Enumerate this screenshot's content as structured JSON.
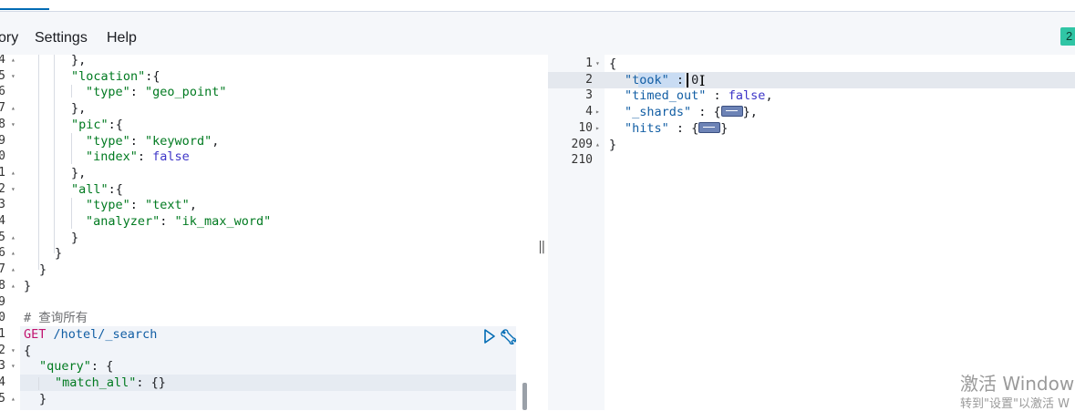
{
  "menu": {
    "history": "ory",
    "settings": "Settings",
    "help": "Help"
  },
  "status_badge": "2",
  "request_editor": {
    "lines": [
      {
        "num": "4",
        "fold": "▴",
        "code": [
          [
            "p",
            "},"
          ]
        ]
      },
      {
        "num": "5",
        "fold": "▾",
        "code": [
          [
            "s",
            "\"location\""
          ],
          [
            "p",
            ":{"
          ]
        ]
      },
      {
        "num": "6",
        "fold": "",
        "code": [
          [
            "s",
            "\"type\""
          ],
          [
            "p",
            ": "
          ],
          [
            "s",
            "\"geo_point\""
          ]
        ]
      },
      {
        "num": "7",
        "fold": "▴",
        "code": [
          [
            "p",
            "},"
          ]
        ]
      },
      {
        "num": "8",
        "fold": "▾",
        "code": [
          [
            "s",
            "\"pic\""
          ],
          [
            "p",
            ":{"
          ]
        ]
      },
      {
        "num": "9",
        "fold": "",
        "code": [
          [
            "s",
            "\"type\""
          ],
          [
            "p",
            ": "
          ],
          [
            "s",
            "\"keyword\""
          ],
          [
            "p",
            ","
          ]
        ]
      },
      {
        "num": "0",
        "fold": "",
        "code": [
          [
            "s",
            "\"index\""
          ],
          [
            "p",
            ": "
          ],
          [
            "b",
            "false"
          ]
        ]
      },
      {
        "num": "1",
        "fold": "▴",
        "code": [
          [
            "p",
            "},"
          ]
        ]
      },
      {
        "num": "2",
        "fold": "▾",
        "code": [
          [
            "s",
            "\"all\""
          ],
          [
            "p",
            ":{"
          ]
        ]
      },
      {
        "num": "3",
        "fold": "",
        "code": [
          [
            "s",
            "\"type\""
          ],
          [
            "p",
            ": "
          ],
          [
            "s",
            "\"text\""
          ],
          [
            "p",
            ","
          ]
        ]
      },
      {
        "num": "4",
        "fold": "",
        "code": [
          [
            "s",
            "\"analyzer\""
          ],
          [
            "p",
            ": "
          ],
          [
            "s",
            "\"ik_max_word\""
          ]
        ]
      },
      {
        "num": "5",
        "fold": "▴",
        "code": [
          [
            "p",
            "}"
          ]
        ]
      },
      {
        "num": "6",
        "fold": "▴",
        "code": [
          [
            "p",
            "}"
          ]
        ]
      },
      {
        "num": "7",
        "fold": "▴",
        "code": [
          [
            "p",
            "}"
          ]
        ]
      },
      {
        "num": "8",
        "fold": "▴",
        "code": [
          [
            "p",
            "}"
          ]
        ]
      },
      {
        "num": "9",
        "fold": "",
        "code": []
      },
      {
        "num": "0",
        "fold": "",
        "code": [
          [
            "c",
            "# 查询所有"
          ]
        ]
      },
      {
        "num": "1",
        "fold": "",
        "code": [
          [
            "m",
            "GET"
          ],
          [
            "p",
            " "
          ],
          [
            "k",
            "/hotel/_search"
          ]
        ]
      },
      {
        "num": "2",
        "fold": "▾",
        "code": [
          [
            "p",
            "{"
          ]
        ]
      },
      {
        "num": "3",
        "fold": "▾",
        "code": [
          [
            "s",
            "\"query\""
          ],
          [
            "p",
            ": {"
          ]
        ]
      },
      {
        "num": "4",
        "fold": "",
        "code": [
          [
            "s",
            "\"match_all\""
          ],
          [
            "p",
            ": {}"
          ]
        ]
      },
      {
        "num": "5",
        "fold": "▴",
        "code": [
          [
            "p",
            "}"
          ]
        ]
      }
    ]
  },
  "response_viewer": {
    "lines": [
      {
        "num": "1",
        "fold": "▾",
        "code": [
          [
            "p",
            "{"
          ]
        ]
      },
      {
        "num": "2",
        "fold": "",
        "code": [
          [
            "k",
            "\"took\""
          ],
          [
            "p",
            " : "
          ],
          [
            "p",
            "0"
          ]
        ]
      },
      {
        "num": "3",
        "fold": "",
        "code": [
          [
            "k",
            "\"timed_out\""
          ],
          [
            "p",
            " : "
          ],
          [
            "b",
            "false"
          ],
          [
            "p",
            ","
          ]
        ]
      },
      {
        "num": "4",
        "fold": "▸",
        "code": [
          [
            "k",
            "\"_shards\""
          ],
          [
            "p",
            " : {"
          ],
          [
            "w",
            ""
          ],
          [
            "p",
            "},"
          ]
        ]
      },
      {
        "num": "10",
        "fold": "▸",
        "code": [
          [
            "k",
            "\"hits\""
          ],
          [
            "p",
            " : {"
          ],
          [
            "w",
            ""
          ],
          [
            "p",
            "}"
          ]
        ]
      },
      {
        "num": "209",
        "fold": "▴",
        "code": [
          [
            "p",
            "}"
          ]
        ]
      },
      {
        "num": "210",
        "fold": "",
        "code": []
      }
    ]
  },
  "watermark": {
    "title": "激活 Window",
    "subtitle": "转到\"设置\"以激活 W"
  },
  "colors": {
    "accent": "#006bb4",
    "badge": "#30c5a5",
    "json_key": "#125ea4",
    "json_string": "#007a20",
    "json_bool": "#3e36c8",
    "http_method": "#c1136f"
  }
}
